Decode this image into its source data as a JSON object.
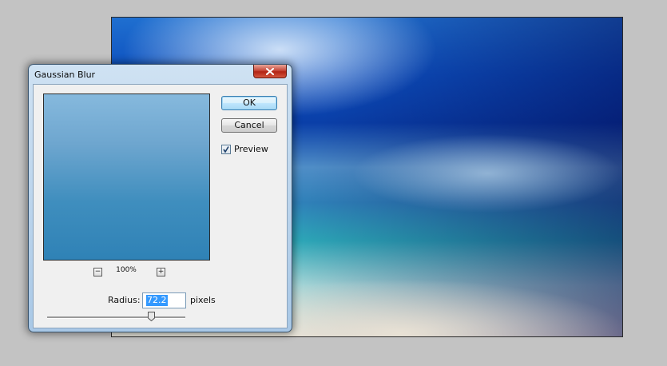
{
  "dialog": {
    "title": "Gaussian Blur",
    "ok_label": "OK",
    "cancel_label": "Cancel",
    "preview_label": "Preview",
    "preview_checked": true,
    "zoom_level": "100%",
    "zoom_out_symbol": "−",
    "zoom_in_symbol": "+",
    "radius_label": "Radius:",
    "radius_value": "72.2",
    "radius_unit": "pixels",
    "slider_fraction": 0.75
  },
  "icons": {
    "close": "close-x-icon",
    "check": "checkmark-icon"
  }
}
